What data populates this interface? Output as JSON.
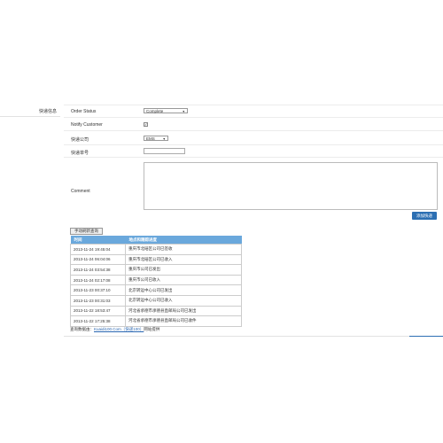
{
  "sidebar": {
    "label": "快递信息"
  },
  "form": {
    "order_status": {
      "label": "Order Status",
      "value": "Complete"
    },
    "notify_customer": {
      "label": "Notify Customer",
      "checked_mark": "✓"
    },
    "courier": {
      "label": "快递公司",
      "value": "EMS"
    },
    "tracking_no": {
      "label": "快递单号",
      "value": ""
    },
    "comment": {
      "label": "Comment",
      "value": ""
    },
    "add_button": "添加快递"
  },
  "manual_query_button": "手动刷新查询",
  "tracking": {
    "headers": [
      "时间",
      "地点和跟踪进度"
    ],
    "rows": [
      [
        "2013-11-24 19:45:04",
        "重庆市北碚区公司已签收"
      ],
      [
        "2013-11-24 06:04:06",
        "重庆市北碚区公司已收入"
      ],
      [
        "2013-11-24 03:54:38",
        "重庆市公司已发出"
      ],
      [
        "2013-11-24 02:17:08",
        "重庆市公司已收入"
      ],
      [
        "2013-11-23 00:37:10",
        "北京转运中心公司已发出"
      ],
      [
        "2013-11-23 00:31:03",
        "北京转运中心公司已收入"
      ],
      [
        "2013-11-22 18:53:47",
        "河北省承德市承德县直邮局公司已发出"
      ],
      [
        "2013-11-22 17:25:38",
        "河北省承德市承德县直邮局公司已收件"
      ]
    ]
  },
  "footer": {
    "prefix": "查询数据由：",
    "link": "Kuaidi100.Com（快递100）",
    "suffix": "网站提供"
  }
}
